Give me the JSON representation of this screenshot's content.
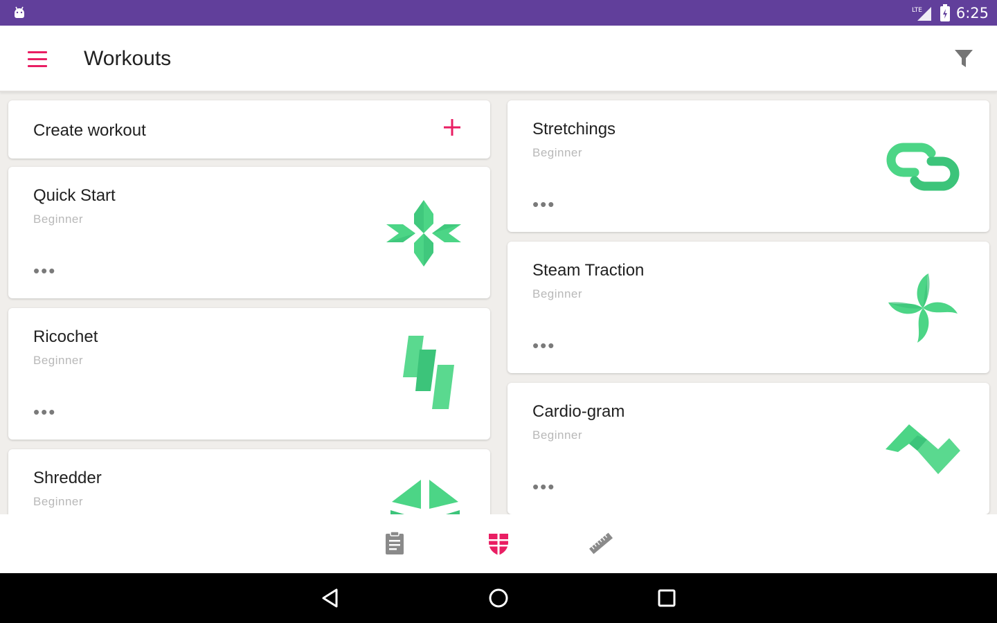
{
  "status_bar": {
    "time": "6:25",
    "network": "LTE"
  },
  "app_bar": {
    "title": "Workouts"
  },
  "create": {
    "label": "Create workout"
  },
  "workouts_left": [
    {
      "title": "Quick Start",
      "level": "Beginner",
      "more": "•••",
      "icon": "snowflake-icon"
    },
    {
      "title": "Ricochet",
      "level": "Beginner",
      "more": "•••",
      "icon": "zigzag-blocks-icon"
    },
    {
      "title": "Shredder",
      "level": "Beginner",
      "more": "•••",
      "icon": "triangles-icon"
    }
  ],
  "workouts_right": [
    {
      "title": "Stretchings",
      "level": "Beginner",
      "more": "•••",
      "icon": "chain-link-icon"
    },
    {
      "title": "Steam Traction",
      "level": "Beginner",
      "more": "•••",
      "icon": "pinwheel-icon"
    },
    {
      "title": "Cardio-gram",
      "level": "Beginner",
      "more": "•••",
      "icon": "zigzag-icon"
    }
  ],
  "bottom_nav": {
    "active": "workouts"
  },
  "colors": {
    "status_bar": "#613f9b",
    "accent": "#e91e63",
    "icon_green": "#4cd586",
    "icon_green_dark": "#3cc47a",
    "background": "#f0eeeb"
  }
}
